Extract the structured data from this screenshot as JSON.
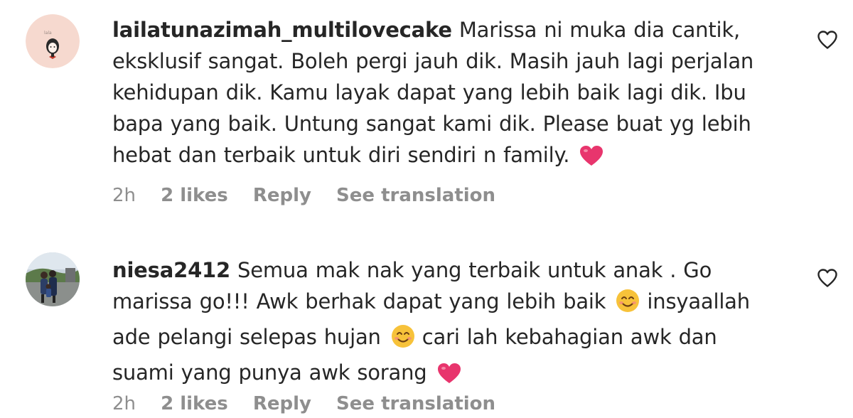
{
  "comments": [
    {
      "username": "lailatunazimah_multilovecake",
      "text_lines": [
        "Marissa ni muka dia cantik,",
        "eksklusif sangat. Boleh pergi jauh dik. Masih jauh lagi perjalan",
        "kehidupan dik. Kamu layak dapat yang lebih baik lagi dik. Ibu",
        "bapa yang baik. Untung sangat kami dik. Please buat yg lebih",
        "hebat dan terbaik untuk diri sendiri n family."
      ],
      "time": "2h",
      "likes": "2 likes",
      "reply": "Reply",
      "translate": "See translation",
      "avatar_icon": "kawaii-girl-avatar",
      "avatar_text": "lala"
    },
    {
      "username": "niesa2412",
      "text_parts": {
        "l1": "Semua mak nak yang terbaik untuk anak . Go",
        "l2a": "marissa go!!! Awk berhak dapat yang lebih baik",
        "l2b": "insyaallah",
        "l3a": "ade pelangi selepas hujan",
        "l3b": "cari lah kebahagian awk dan",
        "l4": "suami yang punya awk sorang"
      },
      "time": "2h",
      "likes": "2 likes",
      "reply": "Reply",
      "translate": "See translation",
      "avatar_icon": "family-photo-avatar"
    }
  ],
  "icons": {
    "like": "heart-outline-icon",
    "emoji_heart": "red-heart-emoji",
    "emoji_smile": "smiling-face-emoji"
  },
  "colors": {
    "text": "#262626",
    "meta": "#8e8e8e",
    "heart_emoji": "#e8356d"
  }
}
